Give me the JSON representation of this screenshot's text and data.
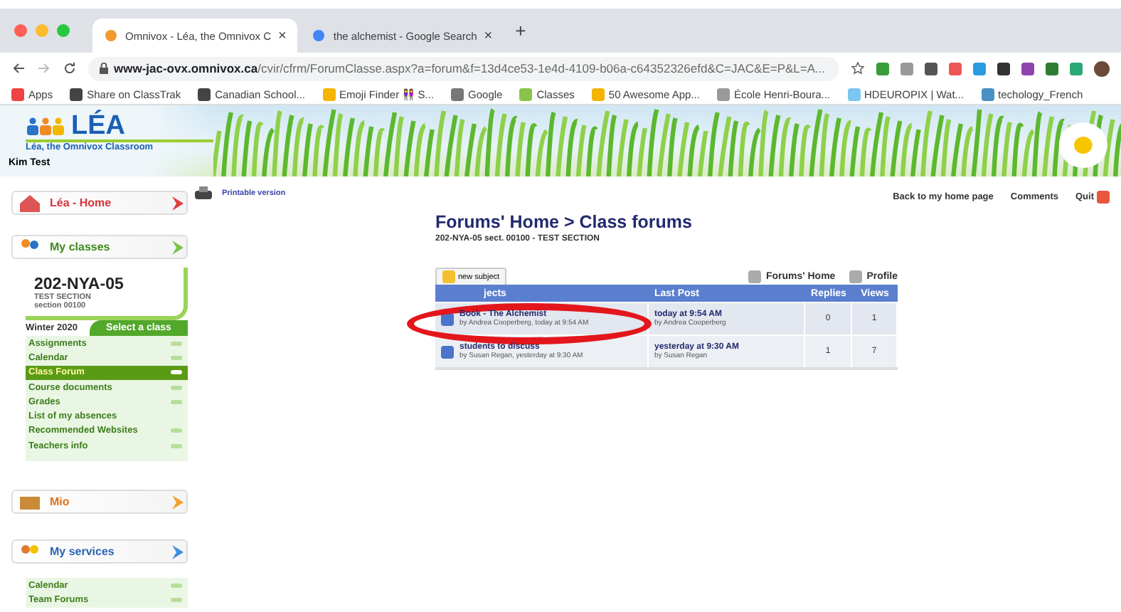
{
  "browser": {
    "tabs": [
      {
        "title": "Omnivox - Léa, the Omnivox C",
        "selected": true,
        "close": "×"
      },
      {
        "title": "the alchemist - Google Search",
        "selected": false,
        "close": "×"
      }
    ],
    "new_tab": "+",
    "address": {
      "domain": "www-jac-ovx.omnivox.ca",
      "path": "/cvir/cfrm/ForumClasse.aspx?a=forum&f=13d4ce53-1e4d-4109-b06a-c64352326efd&C=JAC&E=P&L=A..."
    },
    "bookmarks": [
      {
        "label": "Apps",
        "kind": "apps"
      },
      {
        "label": "Share on ClassTrak",
        "kind": "globe"
      },
      {
        "label": "Canadian School...",
        "kind": "globe"
      },
      {
        "label": "Emoji Finder 👭 S...",
        "kind": "emoji"
      },
      {
        "label": "Google",
        "kind": "folder"
      },
      {
        "label": "Classes",
        "kind": "green"
      },
      {
        "label": "50 Awesome App...",
        "kind": "emoji"
      },
      {
        "label": "École Henri-Boura...",
        "kind": "pen"
      },
      {
        "label": "HDEUROPIX | Wat...",
        "kind": "circle"
      },
      {
        "label": "techology_French",
        "kind": "bird"
      }
    ]
  },
  "banner": {
    "logo": "LÉA",
    "tagline": "Léa, the Omnivox Classroom",
    "user": "Kim Test"
  },
  "sidebar": {
    "home": "Léa - Home",
    "classes_title": "My classes",
    "class_code": "202-NYA-05",
    "class_section": "TEST SECTION",
    "class_group": "section 00100",
    "term": "Winter 2020",
    "select_class": "Select a class",
    "menu": [
      {
        "label": "Assignments",
        "selected": false,
        "arrow": true
      },
      {
        "label": "Calendar",
        "selected": false,
        "arrow": true
      },
      {
        "label": "Class Forum",
        "selected": true,
        "arrow": true
      },
      {
        "label": "Course documents",
        "selected": false,
        "arrow": true
      },
      {
        "label": "Grades",
        "selected": false,
        "arrow": true
      },
      {
        "label": "List of my absences",
        "selected": false,
        "arrow": false
      },
      {
        "label": "Recommended Websites",
        "selected": false,
        "arrow": true
      },
      {
        "label": "Teachers info",
        "selected": false,
        "arrow": true
      }
    ],
    "mio": "Mio",
    "services_title": "My services",
    "services": [
      {
        "label": "Calendar"
      },
      {
        "label": "Team Forums"
      }
    ]
  },
  "printable": "Printable version",
  "top_links": [
    "Back to my home page",
    "Comments",
    "Quit"
  ],
  "forum": {
    "title": "Forums' Home > Class forums",
    "subtitle": "202-NYA-05 sect. 00100 - TEST SECTION",
    "new_subject": "new subject",
    "links": [
      "Forums' Home",
      "Profile"
    ],
    "columns": [
      "jects",
      "Last Post",
      "Replies",
      "Views"
    ],
    "rows": [
      {
        "title": "Book - The Alchemist",
        "by": "by Andrea Cooperberg, today at 9:54 AM",
        "last_post": "today at 9:54 AM",
        "last_by": "by Andrea Cooperberg",
        "replies": "0",
        "views": "1"
      },
      {
        "title": "students to discuss",
        "by": "by Susan Regan, yesterday at 9:30 AM",
        "last_post": "yesterday at 9:30 AM",
        "last_by": "by Susan Regan",
        "replies": "1",
        "views": "7"
      }
    ]
  }
}
